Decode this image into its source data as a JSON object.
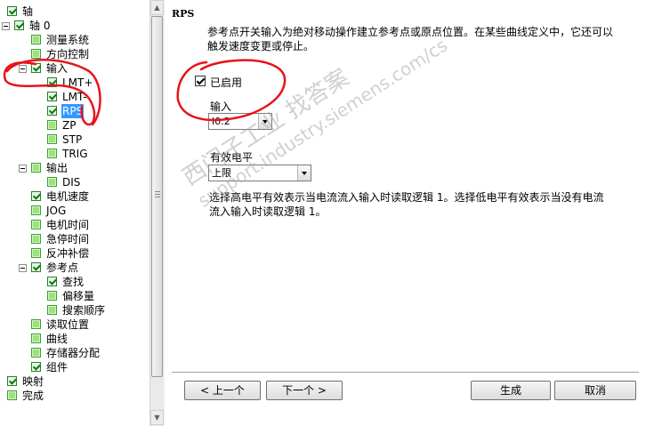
{
  "tree": {
    "items": [
      {
        "label": "轴",
        "state": "on",
        "indent": 0,
        "expander": false
      },
      {
        "label": "轴 0",
        "state": "on",
        "indent": 1,
        "expander": true
      },
      {
        "label": "测量系统",
        "state": "off",
        "indent": 2,
        "expander": false
      },
      {
        "label": "方向控制",
        "state": "off",
        "indent": 2,
        "expander": false
      },
      {
        "label": "输入",
        "state": "on",
        "indent": 2,
        "expander": true
      },
      {
        "label": "LMT+",
        "state": "on",
        "indent": 3,
        "expander": false
      },
      {
        "label": "LMT-",
        "state": "on",
        "indent": 3,
        "expander": false
      },
      {
        "label": "RPS",
        "state": "on",
        "indent": 3,
        "expander": false,
        "selected": true
      },
      {
        "label": "ZP",
        "state": "off",
        "indent": 3,
        "expander": false
      },
      {
        "label": "STP",
        "state": "off",
        "indent": 3,
        "expander": false
      },
      {
        "label": "TRIG",
        "state": "off",
        "indent": 3,
        "expander": false
      },
      {
        "label": "输出",
        "state": "off",
        "indent": 2,
        "expander": true
      },
      {
        "label": "DIS",
        "state": "off",
        "indent": 3,
        "expander": false
      },
      {
        "label": "电机速度",
        "state": "on",
        "indent": 2,
        "expander": false
      },
      {
        "label": "JOG",
        "state": "off",
        "indent": 2,
        "expander": false
      },
      {
        "label": "电机时间",
        "state": "off",
        "indent": 2,
        "expander": false
      },
      {
        "label": "急停时间",
        "state": "off",
        "indent": 2,
        "expander": false
      },
      {
        "label": "反冲补偿",
        "state": "off",
        "indent": 2,
        "expander": false
      },
      {
        "label": "参考点",
        "state": "on",
        "indent": 2,
        "expander": true
      },
      {
        "label": "查找",
        "state": "on",
        "indent": 3,
        "expander": false
      },
      {
        "label": "偏移量",
        "state": "off",
        "indent": 3,
        "expander": false
      },
      {
        "label": "搜索顺序",
        "state": "off",
        "indent": 3,
        "expander": false
      },
      {
        "label": "读取位置",
        "state": "off",
        "indent": 2,
        "expander": false
      },
      {
        "label": "曲线",
        "state": "off",
        "indent": 2,
        "expander": false
      },
      {
        "label": "存储器分配",
        "state": "off",
        "indent": 2,
        "expander": false
      },
      {
        "label": "组件",
        "state": "on",
        "indent": 2,
        "expander": false
      },
      {
        "label": "映射",
        "state": "on",
        "indent": 0,
        "expander": false
      },
      {
        "label": "完成",
        "state": "off",
        "indent": 0,
        "expander": false
      }
    ]
  },
  "content": {
    "title": "RPS",
    "description": "参考点开关输入为绝对移动操作建立参考点或原点位置。在某些曲线定义中，它还可以触发速度变更或停止。",
    "enable_label": "已启用",
    "enable_checked": true,
    "input_label": "输入",
    "input_value": "I0.2",
    "level_label": "有效电平",
    "level_value": "上限",
    "help_text": "选择高电平有效表示当电流流入输入时读取逻辑 1。选择低电平有效表示当没有电流流入输入时读取逻辑 1。"
  },
  "buttons": {
    "prev": "< 上一个",
    "next": "下一个 >",
    "generate": "生成",
    "cancel": "取消"
  },
  "watermark": {
    "line1": "西门子工业  找答案",
    "line2": "support.industry.siemens.com/cs"
  },
  "colors": {
    "selection": "#3399ff",
    "annotation": "#e8131a",
    "check_green": "#0a7a0a"
  }
}
